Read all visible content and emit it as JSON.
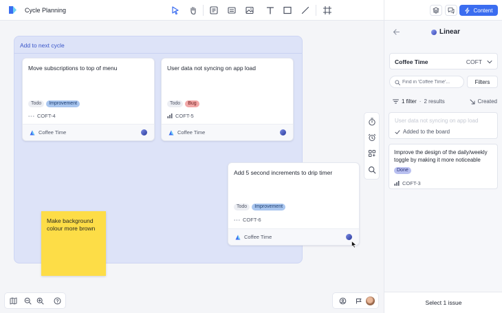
{
  "app": {
    "title": "Cycle Planning"
  },
  "toolbar": {
    "tools": [
      "select-icon",
      "hand-icon",
      "note-icon",
      "card-icon",
      "image-icon",
      "text-icon",
      "rectangle-icon",
      "line-icon",
      "frame-icon"
    ],
    "content_label": "Content"
  },
  "frame": {
    "label": "Add to next cycle"
  },
  "cards": [
    {
      "title": "Move subscriptions to top of menu",
      "tags": [
        "Todo",
        "Improvement"
      ],
      "issue_id": "COFT-4",
      "team": "Coffee Time"
    },
    {
      "title": "User data not syncing on app load",
      "tags": [
        "Todo",
        "Bug"
      ],
      "issue_id": "COFT-5",
      "team": "Coffee Time"
    },
    {
      "title": "Add 5 second increments to drip timer",
      "tags": [
        "Todo",
        "Improvement"
      ],
      "issue_id": "COFT-6",
      "team": "Coffee Time"
    }
  ],
  "sticky": {
    "text": "Make background colour more brown",
    "color": "#fddd47"
  },
  "panel": {
    "title": "Linear",
    "team_name": "Coffee Time",
    "team_key": "COFT",
    "search_placeholder": "Find in 'Coffee Time'...",
    "filters_label": "Filters",
    "filter_count": "1 filter",
    "results_count": "2 results",
    "sort_label": "Created",
    "results": [
      {
        "title": "User data not syncing on app load",
        "status": "Added to the board"
      },
      {
        "title": "Improve the design of the daily/weekly toggle by making it more noticeable",
        "tag": "Done",
        "issue_id": "COFT-3"
      }
    ],
    "footer": "Select 1 issue"
  },
  "colors": {
    "accent": "#3b6df0",
    "frame_bg": "#dde3f8",
    "improvement": "#a9c6ef",
    "bug": "#f2a8a8",
    "done": "#b9c0f0"
  }
}
